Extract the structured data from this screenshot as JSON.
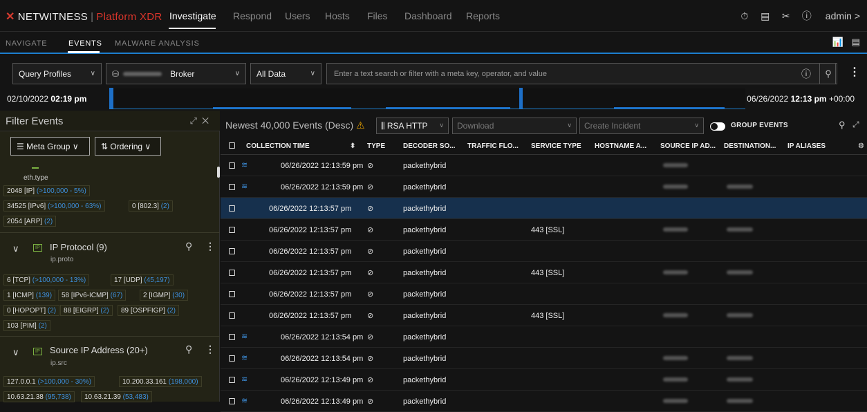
{
  "brand": {
    "name": "NETWITNESS",
    "product": "Platform XDR"
  },
  "nav": {
    "items": [
      "Investigate",
      "Respond",
      "Users",
      "Hosts",
      "Files",
      "Dashboard",
      "Reports"
    ],
    "active": "Investigate"
  },
  "user": {
    "name": "admin >"
  },
  "subnav": {
    "tabs": [
      "NAVIGATE",
      "EVENTS",
      "MALWARE ANALYSIS"
    ],
    "active": "EVENTS"
  },
  "query": {
    "profiles": "Query Profiles",
    "service": "Broker",
    "data": "All Data",
    "placeholder": "Enter a text search or filter with a meta key, operator, and value"
  },
  "timeline": {
    "start_date": "02/10/2022",
    "start_time": "02:19 pm",
    "end_date": "06/26/2022",
    "end_time": "12:13 pm",
    "end_tz": "+00:00"
  },
  "filter": {
    "title": "Filter Events",
    "meta_group": "Meta Group",
    "ordering": "Ordering",
    "eth_key": "eth.type",
    "eth_chips": [
      {
        "label": "2048 [IP]",
        "count": "(>100,000 - 5%)"
      },
      {
        "label": "34525 [IPv6]",
        "count": "(>100,000 - 63%)"
      },
      {
        "label": "0 [802.3]",
        "count": "(2)"
      },
      {
        "label": "2054 [ARP]",
        "count": "(2)"
      }
    ],
    "ip_proto": {
      "title": "IP Protocol (9)",
      "key": "ip.proto"
    },
    "proto_chips": [
      {
        "label": "6 [TCP]",
        "count": "(>100,000 - 13%)"
      },
      {
        "label": "17 [UDP]",
        "count": "(45,197)"
      },
      {
        "label": "1 [ICMP]",
        "count": "(139)"
      },
      {
        "label": "58 [IPv6-ICMP]",
        "count": "(67)"
      },
      {
        "label": "2 [IGMP]",
        "count": "(30)"
      },
      {
        "label": "0 [HOPOPT]",
        "count": "(2)"
      },
      {
        "label": "88 [EIGRP]",
        "count": "(2)"
      },
      {
        "label": "89 [OSPFIGP]",
        "count": "(2)"
      },
      {
        "label": "103 [PIM]",
        "count": "(2)"
      }
    ],
    "src_ip": {
      "title": "Source IP Address (20+)",
      "key": "ip.src"
    },
    "src_chips": [
      {
        "label": "127.0.0.1",
        "count": "(>100,000 - 30%)"
      },
      {
        "label": "10.200.33.161",
        "count": "(198,000)"
      },
      {
        "label": "10.63.21.38",
        "count": "(95,738)"
      },
      {
        "label": "10.63.21.39",
        "count": "(53,483)"
      }
    ]
  },
  "events": {
    "title": "Newest 40,000 Events (Desc)",
    "profile": "RSA HTTP",
    "download": "Download",
    "incident": "Create Incident",
    "group_label": "GROUP EVENTS",
    "columns": [
      "COLLECTION TIME",
      "TYPE",
      "DECODER SO...",
      "TRAFFIC FLO...",
      "SERVICE TYPE",
      "HOSTNAME A...",
      "SOURCE IP AD...",
      "DESTINATION...",
      "IP ALIASES"
    ],
    "rows": [
      {
        "time": "06/26/2022 12:13:59 pm",
        "decoder": "packethybrid",
        "service": "",
        "grouped": true,
        "selected": false,
        "src": true,
        "dst": false
      },
      {
        "time": "06/26/2022 12:13:59 pm",
        "decoder": "packethybrid",
        "service": "",
        "grouped": true,
        "selected": false,
        "src": true,
        "dst": true
      },
      {
        "time": "06/26/2022 12:13:57 pm",
        "decoder": "packethybrid",
        "service": "",
        "grouped": false,
        "selected": true,
        "src": false,
        "dst": false
      },
      {
        "time": "06/26/2022 12:13:57 pm",
        "decoder": "packethybrid",
        "service": "443 [SSL]",
        "grouped": false,
        "selected": false,
        "src": true,
        "dst": true
      },
      {
        "time": "06/26/2022 12:13:57 pm",
        "decoder": "packethybrid",
        "service": "",
        "grouped": false,
        "selected": false,
        "src": false,
        "dst": false
      },
      {
        "time": "06/26/2022 12:13:57 pm",
        "decoder": "packethybrid",
        "service": "443 [SSL]",
        "grouped": false,
        "selected": false,
        "src": true,
        "dst": true
      },
      {
        "time": "06/26/2022 12:13:57 pm",
        "decoder": "packethybrid",
        "service": "",
        "grouped": false,
        "selected": false,
        "src": false,
        "dst": false
      },
      {
        "time": "06/26/2022 12:13:57 pm",
        "decoder": "packethybrid",
        "service": "443 [SSL]",
        "grouped": false,
        "selected": false,
        "src": true,
        "dst": true
      },
      {
        "time": "06/26/2022 12:13:54 pm",
        "decoder": "packethybrid",
        "service": "",
        "grouped": true,
        "selected": false,
        "src": false,
        "dst": false
      },
      {
        "time": "06/26/2022 12:13:54 pm",
        "decoder": "packethybrid",
        "service": "",
        "grouped": true,
        "selected": false,
        "src": true,
        "dst": true
      },
      {
        "time": "06/26/2022 12:13:49 pm",
        "decoder": "packethybrid",
        "service": "",
        "grouped": true,
        "selected": false,
        "src": true,
        "dst": true
      },
      {
        "time": "06/26/2022 12:13:49 pm",
        "decoder": "packethybrid",
        "service": "",
        "grouped": true,
        "selected": false,
        "src": true,
        "dst": true
      }
    ]
  }
}
